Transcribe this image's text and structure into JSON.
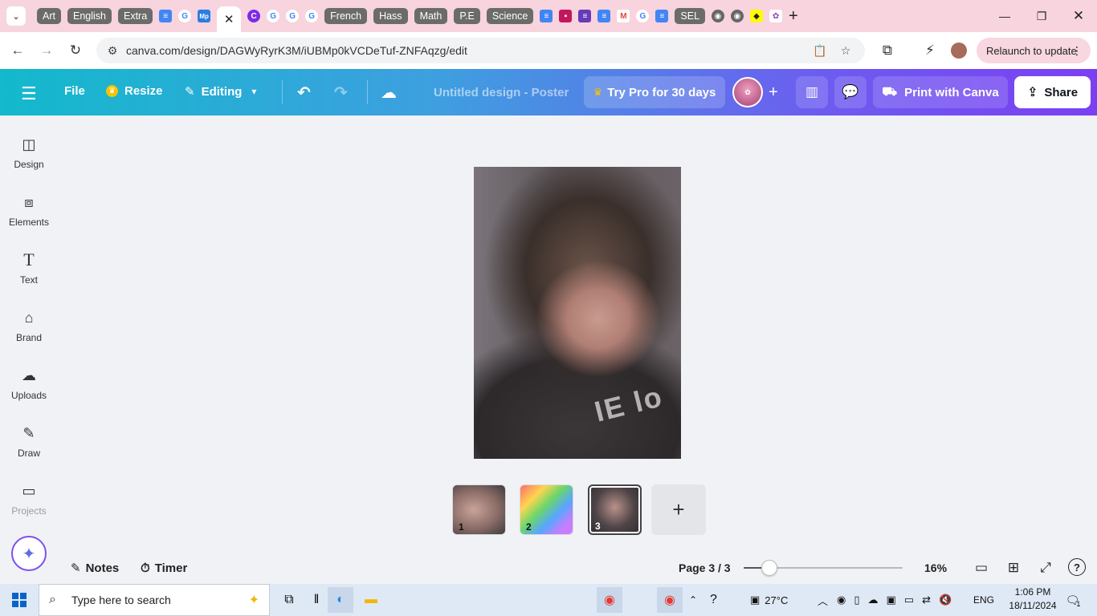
{
  "browser": {
    "tabs": [
      {
        "type": "pill",
        "label": "Art"
      },
      {
        "type": "pill",
        "label": "English"
      },
      {
        "type": "pill",
        "label": "Extra"
      },
      {
        "type": "icon",
        "icon": "docs-icon"
      },
      {
        "type": "icon",
        "icon": "google-icon"
      },
      {
        "type": "icon",
        "icon": "mp-icon"
      },
      {
        "type": "active",
        "icon": "close-icon"
      },
      {
        "type": "icon",
        "icon": "canva-icon"
      },
      {
        "type": "icon",
        "icon": "google-icon"
      },
      {
        "type": "icon",
        "icon": "google-icon"
      },
      {
        "type": "icon",
        "icon": "google-icon"
      },
      {
        "type": "pill",
        "label": "French"
      },
      {
        "type": "pill",
        "label": "Hass"
      },
      {
        "type": "pill",
        "label": "Math"
      },
      {
        "type": "pill",
        "label": "P.E"
      },
      {
        "type": "pill",
        "label": "Science"
      },
      {
        "type": "icon",
        "icon": "docs-icon"
      },
      {
        "type": "icon",
        "icon": "contact-icon"
      },
      {
        "type": "icon",
        "icon": "forms-icon"
      },
      {
        "type": "icon",
        "icon": "docs-icon"
      },
      {
        "type": "icon",
        "icon": "gmail-icon"
      },
      {
        "type": "icon",
        "icon": "google-icon"
      },
      {
        "type": "icon",
        "icon": "docs-icon"
      },
      {
        "type": "pill",
        "label": "SEL"
      },
      {
        "type": "icon",
        "icon": "chrome-icon"
      },
      {
        "type": "icon",
        "icon": "chrome-icon"
      },
      {
        "type": "icon",
        "icon": "snapchat-icon"
      },
      {
        "type": "icon",
        "icon": "photos-icon"
      }
    ],
    "url": "canva.com/design/DAGWyRyrK3M/iUBMp0kVCDeTuf-ZNFAqzg/edit",
    "relaunch_label": "Relaunch to update"
  },
  "toolbar": {
    "file_label": "File",
    "resize_label": "Resize",
    "editing_label": "Editing",
    "title": "Untitled design - Poster",
    "pro_label": "Try Pro for 30 days",
    "print_label": "Print with Canva",
    "share_label": "Share"
  },
  "sidebar": {
    "items": [
      {
        "label": "Design",
        "icon": "design-icon"
      },
      {
        "label": "Elements",
        "icon": "elements-icon"
      },
      {
        "label": "Text",
        "icon": "text-icon"
      },
      {
        "label": "Brand",
        "icon": "brand-icon"
      },
      {
        "label": "Uploads",
        "icon": "uploads-icon"
      },
      {
        "label": "Draw",
        "icon": "draw-icon"
      },
      {
        "label": "Projects",
        "icon": "projects-icon"
      }
    ]
  },
  "poster": {
    "shirt_text": "IE lo"
  },
  "pages": {
    "thumbs": [
      "1",
      "2",
      "3"
    ],
    "selected": 3
  },
  "footer": {
    "notes_label": "Notes",
    "timer_label": "Timer",
    "page_indicator": "Page 3 / 3",
    "zoom_value": "16%",
    "zoom_fraction": 0.16
  },
  "taskbar": {
    "search_placeholder": "Type here to search",
    "temperature": "27°C",
    "language": "ENG",
    "time": "1:06 PM",
    "date": "18/11/2024",
    "notification_count": "1"
  },
  "colors": {
    "tabstrip_bg": "#f7d4de",
    "accent_start": "#13b9cc",
    "accent_end": "#7b3ff2",
    "canvas_bg": "#f1f2f5"
  }
}
